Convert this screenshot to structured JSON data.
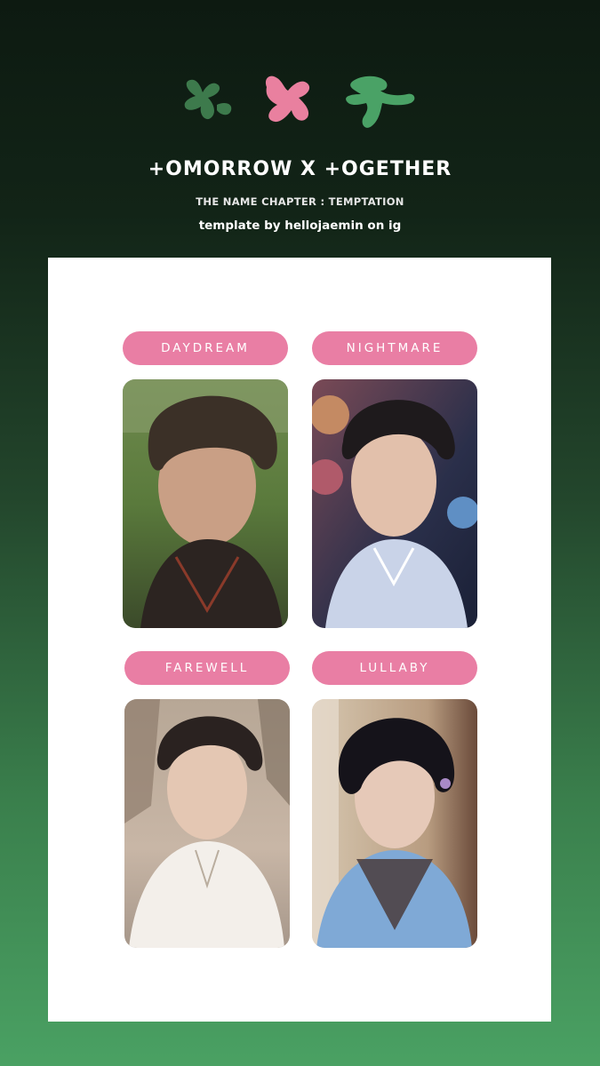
{
  "header": {
    "brand": "+OMORROW X +OGETHER",
    "chapter": "THE NAME CHAPTER : TEMPTATION",
    "credit": "template by hellojaemin on ig",
    "logo_colors": [
      "#3d7a4c",
      "#e9809f",
      "#4aa266"
    ]
  },
  "cards": [
    {
      "label": "DAYDREAM",
      "photo": "portrait-photo"
    },
    {
      "label": "NIGHTMARE",
      "photo": "portrait-photo"
    },
    {
      "label": "FAREWELL",
      "photo": "portrait-photo"
    },
    {
      "label": "LULLABY",
      "photo": "portrait-photo"
    }
  ],
  "colors": {
    "pill": "#e97ea4",
    "panel": "#ffffff",
    "background_top": "#0d1a11",
    "background_bottom": "#4aa163"
  }
}
